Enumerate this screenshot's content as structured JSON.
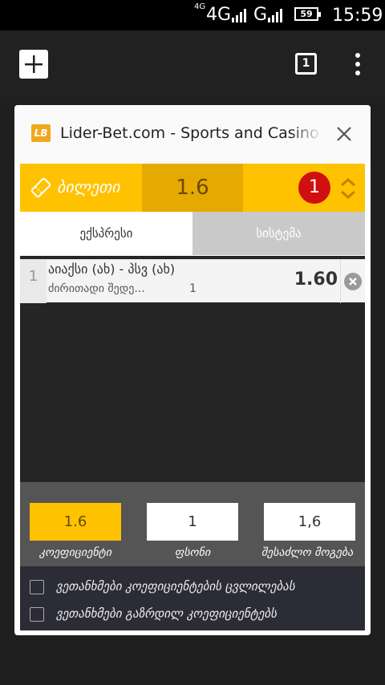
{
  "status_bar": {
    "network_label_small": "4G",
    "network_label": "4G",
    "network2_label": "G",
    "battery": "59",
    "time": "15:59"
  },
  "browser": {
    "tab_count": "1",
    "page_title": "Lider-Bet.com - Sports and Casino Gam",
    "favicon_text": "LB"
  },
  "betslip": {
    "ticket_label": "ბილეთი",
    "total_odds": "1.6",
    "bet_count": "1",
    "tabs": [
      {
        "label": "ექსპრესი",
        "active": true
      },
      {
        "label": "სისტემა",
        "active": false
      }
    ],
    "bets": [
      {
        "number": "1",
        "match": "აიაქსი (ახ) - პსვ (ახ)",
        "market": "ძირითადი შედე...",
        "pick": "1",
        "odds": "1.60"
      }
    ],
    "summary": {
      "coefficient_value": "1.6",
      "coefficient_label": "კოეფიციენტი",
      "stake_value": "1",
      "stake_label": "ფსონი",
      "payout_value": "1,6",
      "payout_label": "შესაძლო მოგება"
    },
    "options": [
      {
        "label": "ვეთანხმები კოეფიციენტების ცვლილებას",
        "checked": false
      },
      {
        "label": "ვეთანხმები გაზრდილ კოეფიციენტებს",
        "checked": false
      }
    ]
  },
  "colors": {
    "accent": "#ffc200",
    "accent_dark": "#e6a900",
    "badge": "#d01010"
  }
}
